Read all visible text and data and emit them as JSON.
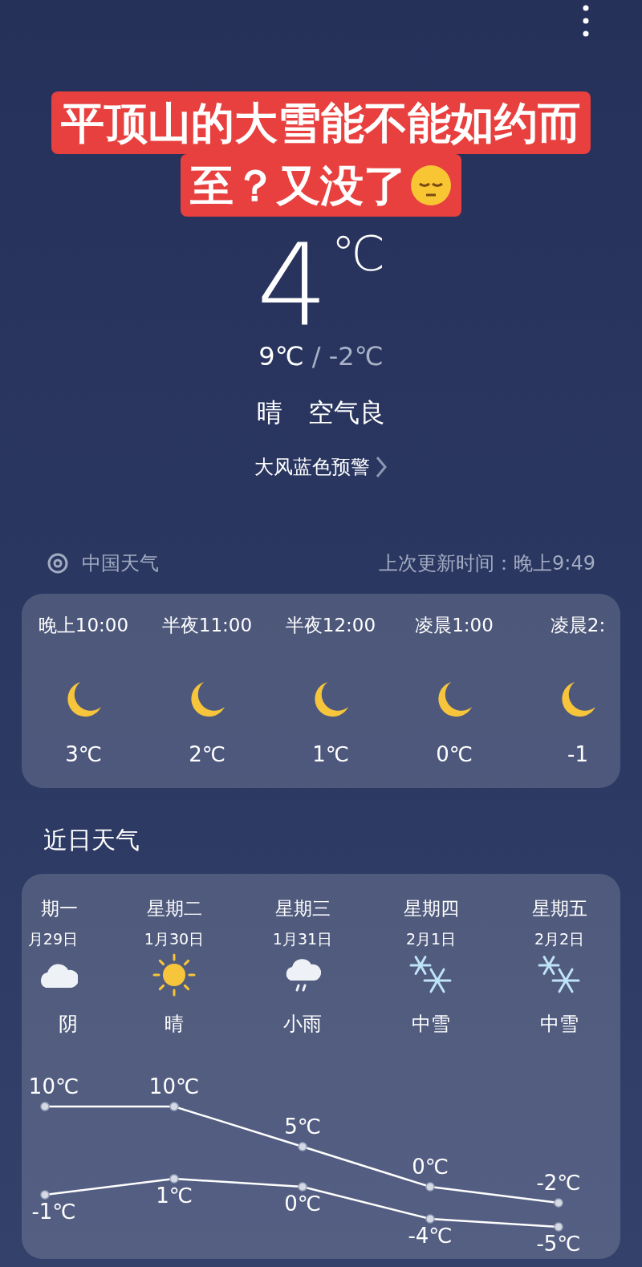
{
  "caption": {
    "lines": [
      "平顶山的大雪能不能如约而",
      "至？又没了"
    ]
  },
  "current": {
    "temperature": "4",
    "unit": "℃",
    "high": "9℃",
    "separator": "/",
    "low": "-2℃",
    "condition": "晴",
    "air_quality": "空气良",
    "alert": "大风蓝色预警"
  },
  "source": {
    "name": "中国天气",
    "updated": "上次更新时间：晚上9:49"
  },
  "hourly": [
    {
      "time": "晚上10:00",
      "kind": "moon",
      "temp": "3℃"
    },
    {
      "time": "半夜11:00",
      "kind": "moon",
      "temp": "2℃"
    },
    {
      "time": "半夜12:00",
      "kind": "moon",
      "temp": "1℃"
    },
    {
      "time": "凌晨1:00",
      "kind": "moon",
      "temp": "0℃"
    },
    {
      "time": "凌晨2:",
      "kind": "moon",
      "temp": "-1"
    }
  ],
  "daily_title": "近日天气",
  "daily": [
    {
      "weekday": "期一",
      "date": "月29日",
      "kind": "cloudy",
      "condition": "阴"
    },
    {
      "weekday": "星期二",
      "date": "1月30日",
      "kind": "sunny",
      "condition": "晴"
    },
    {
      "weekday": "星期三",
      "date": "1月31日",
      "kind": "rain",
      "condition": "小雨"
    },
    {
      "weekday": "星期四",
      "date": "2月1日",
      "kind": "snow",
      "condition": "中雪"
    },
    {
      "weekday": "星期五",
      "date": "2月2日",
      "kind": "snow",
      "condition": "中雪"
    }
  ],
  "chart_data": {
    "type": "line",
    "series": [
      {
        "color": "#ffffff",
        "marker": "circle",
        "values": [
          10,
          10,
          5,
          0,
          -2
        ],
        "value_labels": [
          "10℃",
          "10℃",
          "5℃",
          "0℃",
          "-2℃"
        ]
      },
      {
        "color": "#ffffff",
        "marker": "circle",
        "values": [
          -1,
          1,
          0,
          -4,
          -5
        ],
        "value_labels": [
          "-1℃",
          "1℃",
          "0℃",
          "-4℃",
          "-5℃"
        ]
      }
    ]
  }
}
